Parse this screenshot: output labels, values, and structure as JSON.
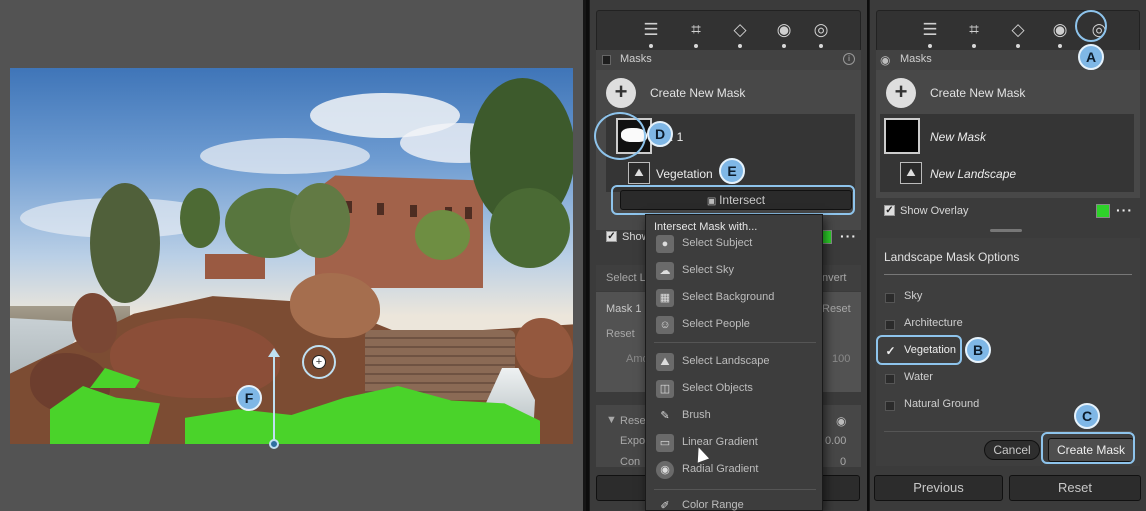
{
  "photo": {
    "callout_f": "F"
  },
  "mid_panel": {
    "masks_label": "Masks",
    "create_new_mask": "Create New Mask",
    "mask_name_partial": ": 1",
    "sub_mask_label": "Vegetation",
    "intersect_button": "Intersect",
    "show_overlay_partial": "Show",
    "select_row_left": "Select L",
    "select_row_right": "nvert",
    "mask1_label": "Mask 1",
    "mask1_reset": "Reset",
    "reset_label": "Reset",
    "amount_label": "Amo",
    "amount_value": "100",
    "reset_section_label": "Rese",
    "exposure_label": "Expo",
    "exposure_value": "0.00",
    "contrast_label": "Con",
    "contrast_value": "0",
    "previous_partial": "Pr",
    "callout_d": "D",
    "callout_e": "E"
  },
  "dropdown": {
    "header": "Intersect Mask with...",
    "items": [
      {
        "label": "Select Subject",
        "icon": "subject-icon"
      },
      {
        "label": "Select Sky",
        "icon": "sky-icon"
      },
      {
        "label": "Select Background",
        "icon": "background-icon"
      },
      {
        "label": "Select People",
        "icon": "people-icon"
      },
      {
        "label": "Select Landscape",
        "icon": "landscape-icon"
      },
      {
        "label": "Select Objects",
        "icon": "objects-icon"
      },
      {
        "label": "Brush",
        "icon": "brush-icon"
      },
      {
        "label": "Linear Gradient",
        "icon": "linear-gradient-icon"
      },
      {
        "label": "Radial Gradient",
        "icon": "radial-gradient-icon"
      },
      {
        "label": "Color Range",
        "icon": "color-range-icon"
      }
    ]
  },
  "right_panel": {
    "masks_label": "Masks",
    "create_new_mask": "Create New Mask",
    "new_mask_label": "New Mask",
    "new_landscape_label": "New Landscape",
    "show_overlay": "Show Overlay",
    "options_title": "Landscape Mask Options",
    "options": [
      {
        "label": "Sky",
        "checked": false
      },
      {
        "label": "Architecture",
        "checked": false
      },
      {
        "label": "Vegetation",
        "checked": true
      },
      {
        "label": "Water",
        "checked": false
      },
      {
        "label": "Natural Ground",
        "checked": false
      }
    ],
    "cancel_button": "Cancel",
    "create_mask_button": "Create Mask",
    "previous_button": "Previous",
    "reset_button": "Reset",
    "callout_a": "A",
    "callout_b": "B",
    "callout_c": "C"
  },
  "colors": {
    "overlay_green": "#2ed12a",
    "callout_blue": "#7fb7e6",
    "panel_bg": "#3b3b3b"
  }
}
